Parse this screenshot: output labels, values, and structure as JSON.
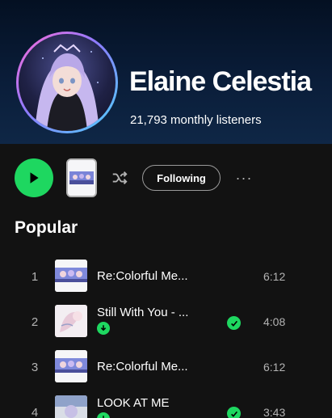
{
  "artist": {
    "name": "Elaine Celestia",
    "listeners": "21,793 monthly listeners"
  },
  "controls": {
    "following_label": "Following",
    "more_label": "···"
  },
  "popular": {
    "title": "Popular",
    "tracks": [
      {
        "num": "1",
        "title": "Re:Colorful Me...",
        "duration": "6:12",
        "liked": false,
        "downloaded": false
      },
      {
        "num": "2",
        "title": "Still With You - ...",
        "duration": "4:08",
        "liked": true,
        "downloaded": true
      },
      {
        "num": "3",
        "title": "Re:Colorful Me...",
        "duration": "6:12",
        "liked": false,
        "downloaded": false
      },
      {
        "num": "4",
        "title": "LOOK AT ME",
        "duration": "3:43",
        "liked": true,
        "downloaded": true
      }
    ]
  },
  "colors": {
    "accent": "#1ed760",
    "background": "#121212",
    "header": "#0a1d39"
  }
}
